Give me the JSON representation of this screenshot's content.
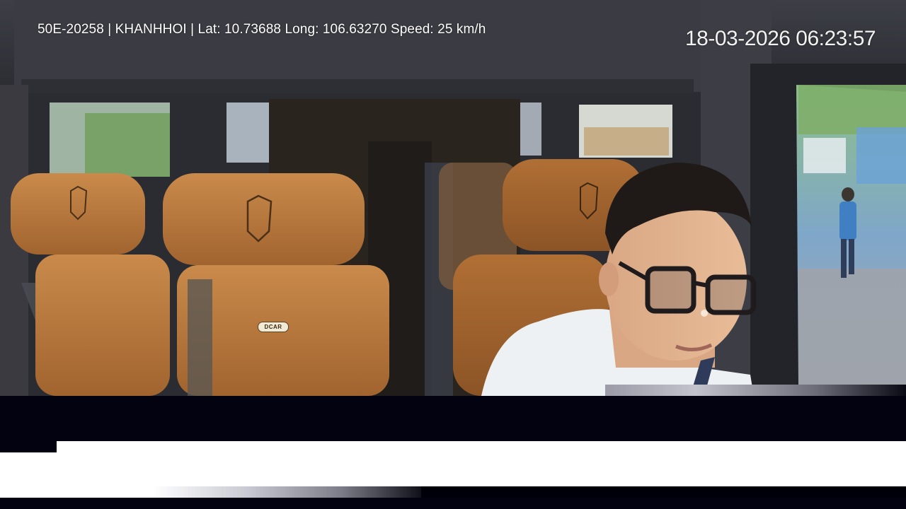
{
  "overlay": {
    "vehicle_info": "50E-20258 | KHANHHOI | Lat: 10.73688 Long: 106.63270 Speed: 25 km/h",
    "timestamp": "18-03-2026 06:23:57"
  },
  "scene": {
    "seat_badge": "DCAR"
  },
  "colors": {
    "overlay_text": "#ffffff",
    "seat_leather": "#c07a3c",
    "headliner": "#3a3b42",
    "shirt": "#f4f6f8",
    "letterbox": "#020211"
  }
}
